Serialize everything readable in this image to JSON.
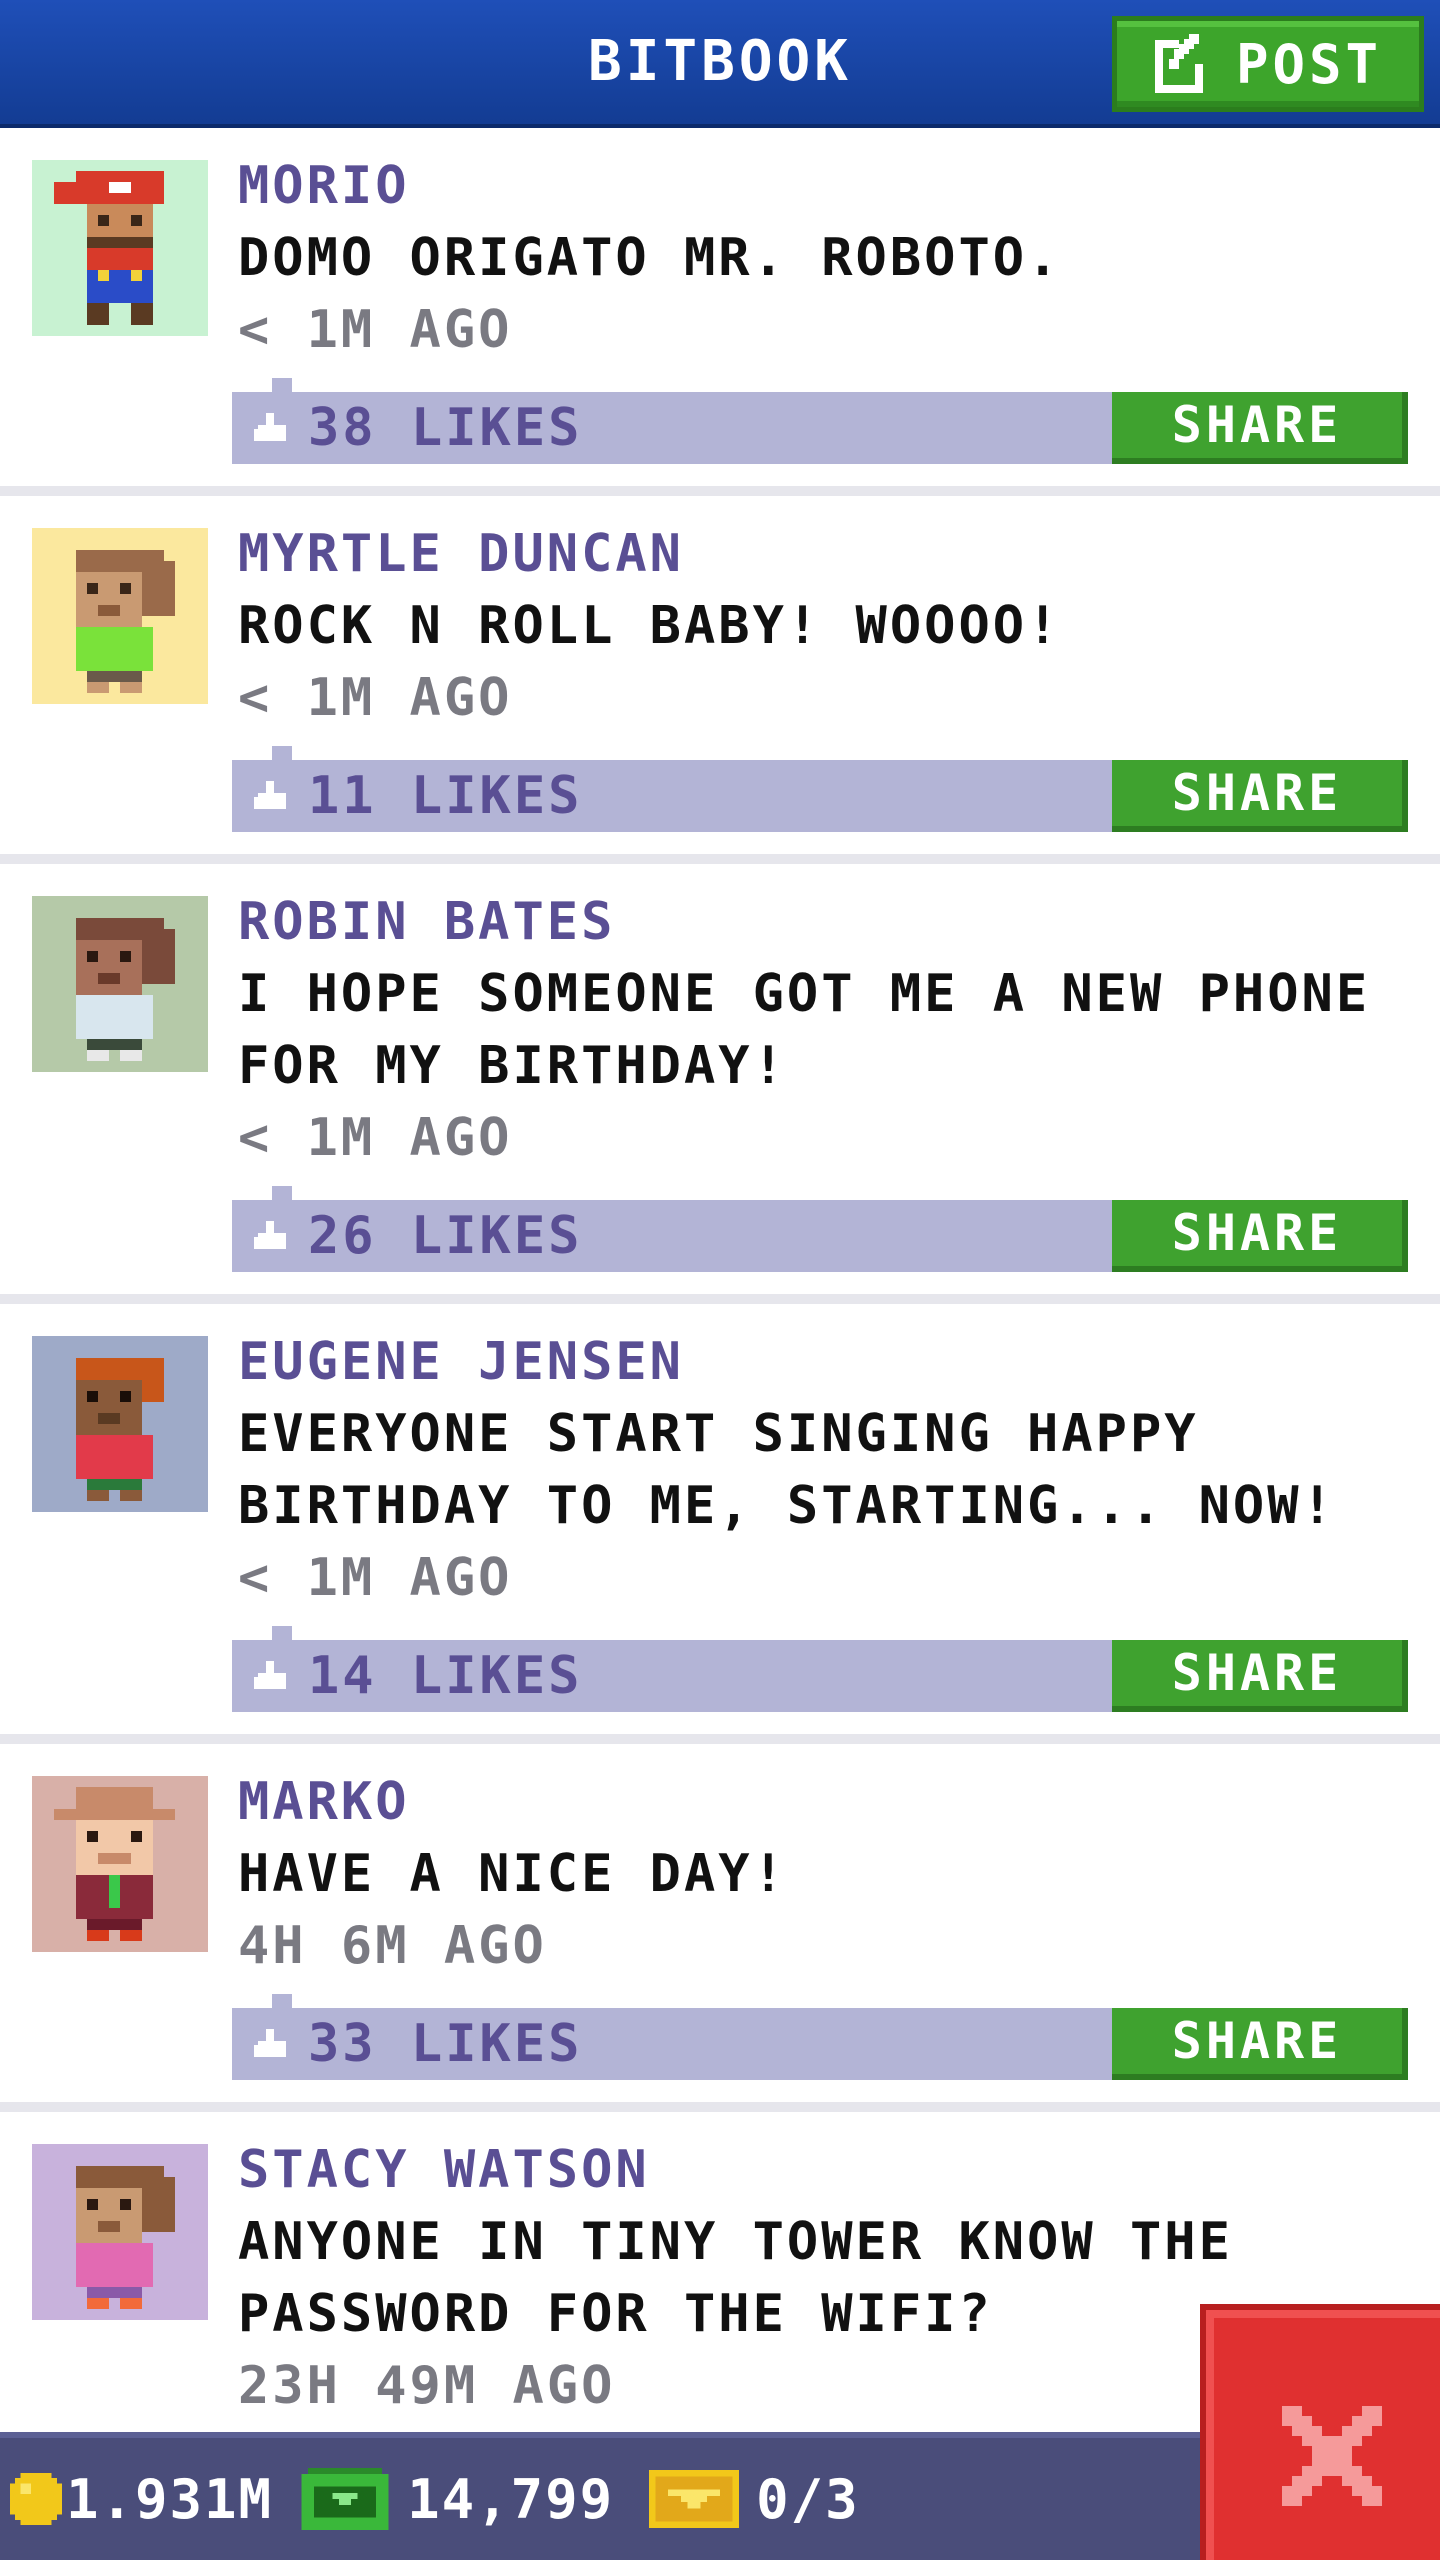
{
  "header": {
    "title": "BITBOOK",
    "post_label": "POST",
    "colors": {
      "bar": "#1a47a8",
      "post_button": "#3da52b"
    }
  },
  "posts": [
    {
      "author": "MORIO",
      "message": "DOMO ORIGATO MR. ROBOTO.",
      "time": "< 1M AGO",
      "likes": "38 LIKES",
      "share_label": "SHARE",
      "avatar_bg": "#c8f2d2",
      "avatar_icon": "mario-like-character-icon"
    },
    {
      "author": "MYRTLE DUNCAN",
      "message": "ROCK N ROLL BABY! WOOOO!",
      "time": "< 1M AGO",
      "likes": "11 LIKES",
      "share_label": "SHARE",
      "avatar_bg": "#fbe89e",
      "avatar_icon": "person-green-shirt-icon"
    },
    {
      "author": "ROBIN BATES",
      "message": "I HOPE SOMEONE GOT ME A NEW PHONE FOR MY BIRTHDAY!",
      "time": "< 1M AGO",
      "likes": "26 LIKES",
      "share_label": "SHARE",
      "avatar_bg": "#b5c9a8",
      "avatar_icon": "person-light-shirt-icon"
    },
    {
      "author": "EUGENE JENSEN",
      "message": "EVERYONE START SINGING HAPPY BIRTHDAY TO ME, STARTING... NOW!",
      "time": "< 1M AGO",
      "likes": "14 LIKES",
      "share_label": "SHARE",
      "avatar_bg": "#9eaac8",
      "avatar_icon": "person-red-shirt-icon"
    },
    {
      "author": "MARKO",
      "message": "HAVE A NICE DAY!",
      "time": "4H 6M AGO",
      "likes": "33 LIKES",
      "share_label": "SHARE",
      "avatar_bg": "#d8b0a8",
      "avatar_icon": "person-hat-icon"
    },
    {
      "author": "STACY WATSON",
      "message": "ANYONE IN TINY TOWER KNOW THE PASSWORD FOR THE WIFI?",
      "time": "23H 49M AGO",
      "likes": "",
      "share_label": "",
      "avatar_bg": "#c8b2dc",
      "avatar_icon": "person-pink-shirt-icon"
    }
  ],
  "status_bar": {
    "coins": "1.931M",
    "bux": "14,799",
    "tickets": "0/3",
    "icons": [
      "coin-icon",
      "bux-icon",
      "ticket-icon"
    ]
  },
  "close_icon": "close-icon"
}
